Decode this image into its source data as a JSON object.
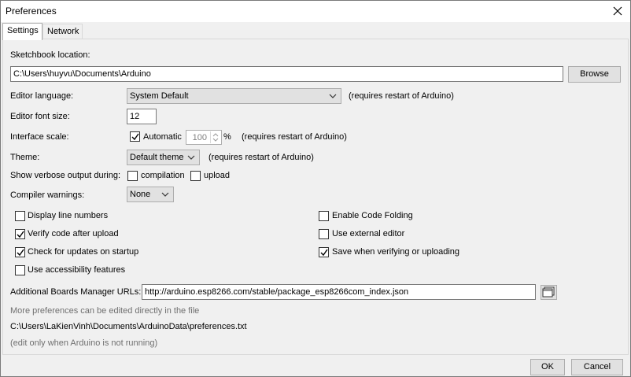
{
  "window": {
    "title": "Preferences"
  },
  "tabs": [
    {
      "label": "Settings"
    },
    {
      "label": "Network"
    }
  ],
  "sketchbook": {
    "label": "Sketchbook location:",
    "value": "C:\\Users\\huyvu\\Documents\\Arduino",
    "browse_label": "Browse"
  },
  "editor_language": {
    "label": "Editor language:",
    "value": "System Default",
    "note": "(requires restart of Arduino)"
  },
  "editor_font_size": {
    "label": "Editor font size:",
    "value": "12"
  },
  "interface_scale": {
    "label": "Interface scale:",
    "automatic_label": "Automatic",
    "automatic_checked": true,
    "value": "100",
    "unit": "%",
    "note": "(requires restart of Arduino)"
  },
  "theme": {
    "label": "Theme:",
    "value": "Default theme",
    "note": "(requires restart of Arduino)"
  },
  "verbose": {
    "label": "Show verbose output during:",
    "compilation_label": "compilation",
    "compilation_checked": false,
    "upload_label": "upload",
    "upload_checked": false
  },
  "compiler_warnings": {
    "label": "Compiler warnings:",
    "value": "None"
  },
  "options_left": [
    {
      "label": "Display line numbers",
      "checked": false
    },
    {
      "label": "Verify code after upload",
      "checked": true
    },
    {
      "label": "Check for updates on startup",
      "checked": true
    },
    {
      "label": "Use accessibility features",
      "checked": false
    }
  ],
  "options_right": [
    {
      "label": "Enable Code Folding",
      "checked": false
    },
    {
      "label": "Use external editor",
      "checked": false
    },
    {
      "label": "Save when verifying or uploading",
      "checked": true
    }
  ],
  "boards_urls": {
    "label": "Additional Boards Manager URLs:",
    "value": "http://arduino.esp8266.com/stable/package_esp8266com_index.json"
  },
  "more_prefs": {
    "line1": "More preferences can be edited directly in the file",
    "path": "C:\\Users\\LaKienVinh\\Documents\\ArduinoData\\preferences.txt",
    "line3": "(edit only when Arduino is not running)"
  },
  "footer": {
    "ok_label": "OK",
    "cancel_label": "Cancel"
  }
}
